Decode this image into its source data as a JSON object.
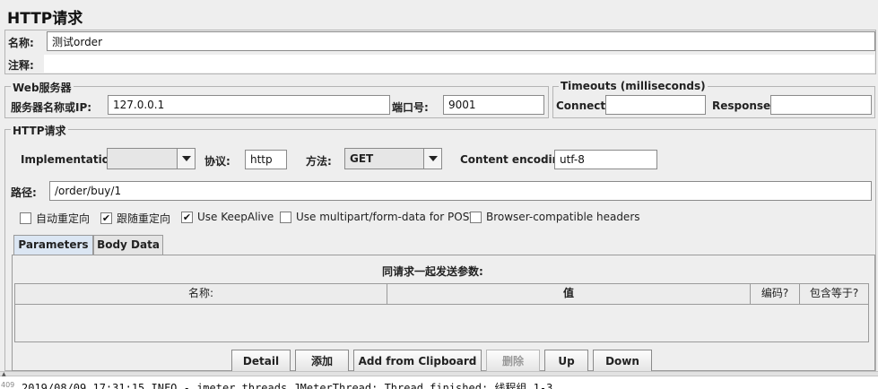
{
  "page_title": "HTTP请求",
  "name": {
    "label": "名称:",
    "value": "测试order"
  },
  "comment": {
    "label": "注释:",
    "value": ""
  },
  "web_server": {
    "legend": "Web服务器",
    "server_label": "服务器名称或IP:",
    "server_value": "127.0.0.1",
    "port_label": "端口号:",
    "port_value": "9001"
  },
  "timeouts": {
    "legend": "Timeouts (milliseconds)",
    "connect_label": "Connect:",
    "connect_value": "",
    "response_label": "Response:",
    "response_value": ""
  },
  "http_request": {
    "legend": "HTTP请求",
    "implementation_label": "Implementation:",
    "implementation_value": "",
    "protocol_label": "协议:",
    "protocol_value": "http",
    "method_label": "方法:",
    "method_value": "GET",
    "encoding_label": "Content encoding:",
    "encoding_value": "utf-8",
    "path_label": "路径:",
    "path_value": "/order/buy/1"
  },
  "options": [
    {
      "label": "自动重定向",
      "checked": false
    },
    {
      "label": "跟随重定向",
      "checked": true
    },
    {
      "label": "Use KeepAlive",
      "checked": true
    },
    {
      "label": "Use multipart/form-data for POST",
      "checked": false
    },
    {
      "label": "Browser-compatible headers",
      "checked": false
    }
  ],
  "tabs": [
    {
      "label": "Parameters",
      "active": true
    },
    {
      "label": "Body Data",
      "active": false
    }
  ],
  "params": {
    "caption": "同请求一起发送参数:",
    "columns": [
      "名称:",
      "值",
      "编码?",
      "包含等于?"
    ]
  },
  "buttons": {
    "detail": "Detail",
    "add": "添加",
    "add_clipboard": "Add from Clipboard",
    "delete": "删除",
    "up": "Up",
    "down": "Down"
  },
  "log": {
    "line_number": "409",
    "text": "2019/08/09 17:31:15 INFO  - jmeter.threads.JMeterThread: Thread finished: 线程组 1-3"
  }
}
